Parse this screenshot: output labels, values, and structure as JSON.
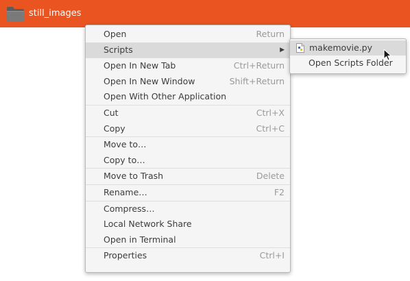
{
  "file": {
    "name": "still_images",
    "icon": "folder-icon"
  },
  "context_menu": {
    "items": [
      {
        "label": "Open",
        "accel": "Return"
      },
      {
        "label": "Scripts",
        "submenu": true,
        "highlighted": true
      },
      {
        "label": "Open In New Tab",
        "accel": "Ctrl+Return"
      },
      {
        "label": "Open In New Window",
        "accel": "Shift+Return"
      },
      {
        "label": "Open With Other Application"
      },
      {
        "label": "Cut",
        "accel": "Ctrl+X"
      },
      {
        "label": "Copy",
        "accel": "Ctrl+C"
      },
      {
        "label": "Move to…"
      },
      {
        "label": "Copy to…"
      },
      {
        "label": "Move to Trash",
        "accel": "Delete"
      },
      {
        "label": "Rename…",
        "accel": "F2"
      },
      {
        "label": "Compress…"
      },
      {
        "label": "Local Network Share"
      },
      {
        "label": "Open in Terminal"
      },
      {
        "label": "Properties",
        "accel": "Ctrl+I"
      }
    ]
  },
  "scripts_submenu": {
    "items": [
      {
        "label": "makemovie.py",
        "icon": "python-script-icon",
        "highlighted": true
      },
      {
        "label": "Open Scripts Folder"
      }
    ]
  },
  "colors": {
    "selection_orange": "#e95420",
    "menu_background": "#f5f5f5",
    "menu_highlight": "#dadada",
    "accelerator_text": "#9a9a9a"
  }
}
